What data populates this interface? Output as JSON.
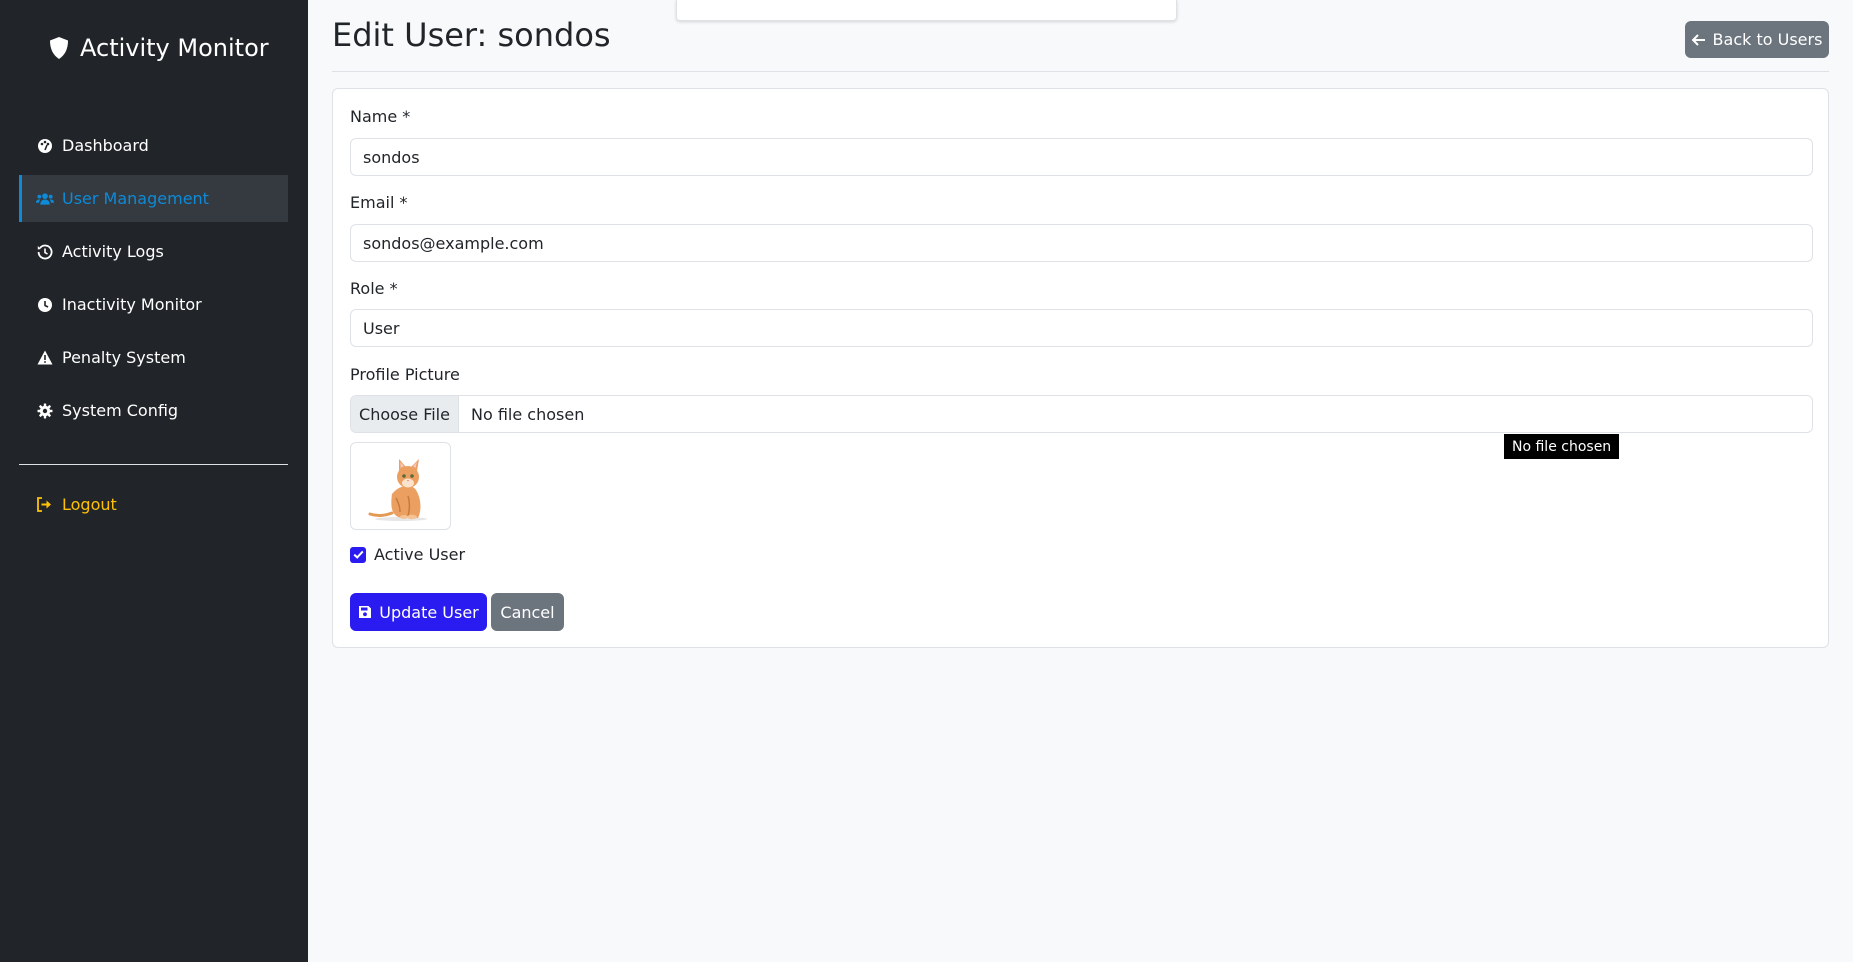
{
  "sidebar": {
    "brand": "Activity Monitor",
    "items": [
      {
        "label": "Dashboard",
        "icon": "palette-icon",
        "active": false
      },
      {
        "label": "User Management",
        "icon": "users-icon",
        "active": true
      },
      {
        "label": "Activity Logs",
        "icon": "history-icon",
        "active": false
      },
      {
        "label": "Inactivity Monitor",
        "icon": "clock-icon",
        "active": false
      },
      {
        "label": "Penalty System",
        "icon": "warning-icon",
        "active": false
      },
      {
        "label": "System Config",
        "icon": "gear-icon",
        "active": false
      }
    ],
    "logout": "Logout"
  },
  "header": {
    "title": "Edit User: sondos",
    "back_label": "Back to Users"
  },
  "form": {
    "name_label": "Name *",
    "name_value": "sondos",
    "email_label": "Email *",
    "email_value": "sondos@example.com",
    "role_label": "Role *",
    "role_value": "User",
    "picture_label": "Profile Picture",
    "choose_file": "Choose File",
    "no_file": "No file chosen",
    "active_label": "Active User",
    "active_checked": true,
    "submit_label": "Update User",
    "cancel_label": "Cancel"
  },
  "tooltip": "No file chosen",
  "colors": {
    "sidebar_bg": "#212529",
    "accent": "#0d8ad8",
    "primary": "#2a1bf0",
    "secondary": "#6c757d",
    "logout": "#ffc107"
  }
}
